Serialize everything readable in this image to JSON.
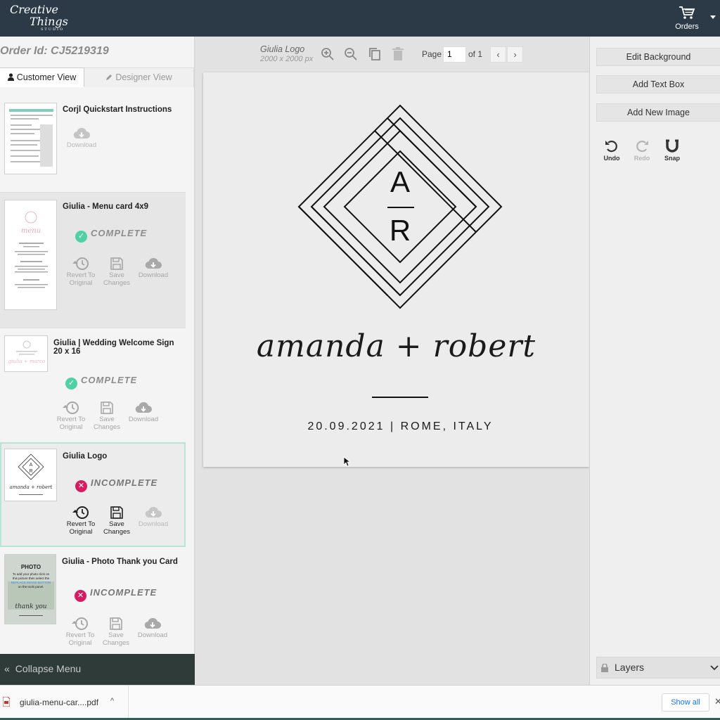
{
  "brand": {
    "line1": "Creative",
    "line2": "Things",
    "line3": "STUDIO"
  },
  "header": {
    "orders_label": "Orders"
  },
  "left": {
    "order_id": "Order Id: CJ5219319",
    "tabs": [
      {
        "label": "Customer View"
      },
      {
        "label": "Designer View"
      }
    ],
    "items": [
      {
        "title": "Corjl Quickstart Instructions",
        "actions": [
          "Download"
        ]
      },
      {
        "title": "Giulia - Menu card 4x9",
        "status": "COMPLETE",
        "actions": [
          "Revert To Original",
          "Save Changes",
          "Download"
        ]
      },
      {
        "title": "Giulia | Wedding Welcome Sign 20 x 16",
        "status": "COMPLETE",
        "actions": [
          "Revert To Original",
          "Save Changes",
          "Download"
        ]
      },
      {
        "title": "Giulia Logo",
        "status": "INCOMPLETE",
        "actions": [
          "Revert To Original",
          "Save Changes",
          "Download"
        ]
      },
      {
        "title": "Giulia - Photo Thank you Card",
        "status": "INCOMPLETE",
        "actions": [
          "Revert To Original",
          "Save Changes",
          "Download"
        ]
      }
    ],
    "collapse_label": "Collapse Menu"
  },
  "editor": {
    "file_name": "Giulia Logo",
    "file_size": "2000 x 2000 px",
    "page_label": "Page",
    "page_value": "1",
    "page_of": "of 1",
    "canvas": {
      "mono_top": "A",
      "mono_bottom": "R",
      "names": "amanda + robert",
      "date_line": "20.09.2021 | ROME, ITALY"
    }
  },
  "right": {
    "buttons": [
      "Edit Background",
      "Add Text Box",
      "Add New Image"
    ],
    "tools": [
      {
        "label": "Undo"
      },
      {
        "label": "Redo"
      },
      {
        "label": "Snap"
      }
    ],
    "layers_label": "Layers"
  },
  "downloads": {
    "file": "giulia-menu-car....pdf",
    "show_all": "Show all"
  },
  "colors": {
    "topbar": "#2c3a48",
    "complete": "#4fd1a5",
    "incomplete": "#d81b60",
    "collapse_bg": "#2f3b38"
  }
}
